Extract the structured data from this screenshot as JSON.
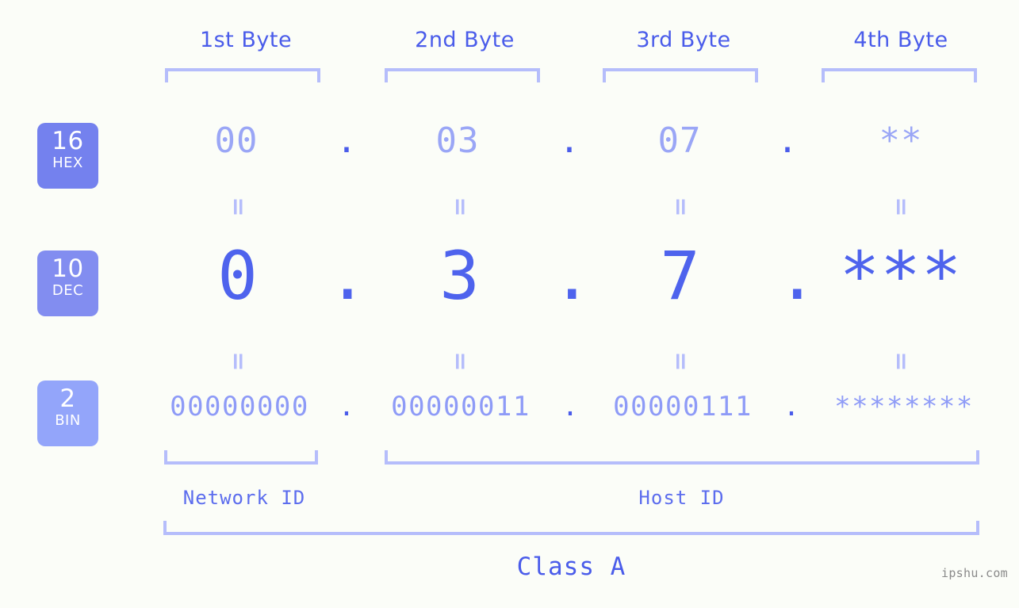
{
  "background": "#fbfdf8",
  "colors": {
    "accent_strong": "#4a5cea",
    "accent_mid": "#7481ee",
    "accent_light": "#9aa6f6",
    "bracket": "#b5bdfb",
    "badge_hex": "#7481ee",
    "badge_dec": "#828df0",
    "badge_bin": "#93a5fa",
    "watermark": "#8a8a8a"
  },
  "columns": [
    {
      "label": "1st Byte"
    },
    {
      "label": "2nd Byte"
    },
    {
      "label": "3rd Byte"
    },
    {
      "label": "4th Byte"
    }
  ],
  "bases": [
    {
      "id": "hex",
      "number": "16",
      "name": "HEX"
    },
    {
      "id": "dec",
      "number": "10",
      "name": "DEC"
    },
    {
      "id": "bin",
      "number": "2",
      "name": "BIN"
    }
  ],
  "rows": {
    "hex": {
      "values": [
        "00",
        "03",
        "07",
        "**"
      ],
      "separators": [
        ".",
        ".",
        "."
      ]
    },
    "dec": {
      "values": [
        "0",
        "3",
        "7",
        "***"
      ],
      "separators": [
        ".",
        ".",
        "."
      ]
    },
    "bin": {
      "values": [
        "00000000",
        "00000011",
        "00000111",
        "********"
      ],
      "separators": [
        ".",
        ".",
        "."
      ]
    }
  },
  "connectors": {
    "symbol": "=",
    "top_row_count": 4,
    "bottom_row_count": 4
  },
  "segments": {
    "network_id": "Network ID",
    "host_id": "Host ID",
    "class": "Class A"
  },
  "watermark": "ipshu.com"
}
